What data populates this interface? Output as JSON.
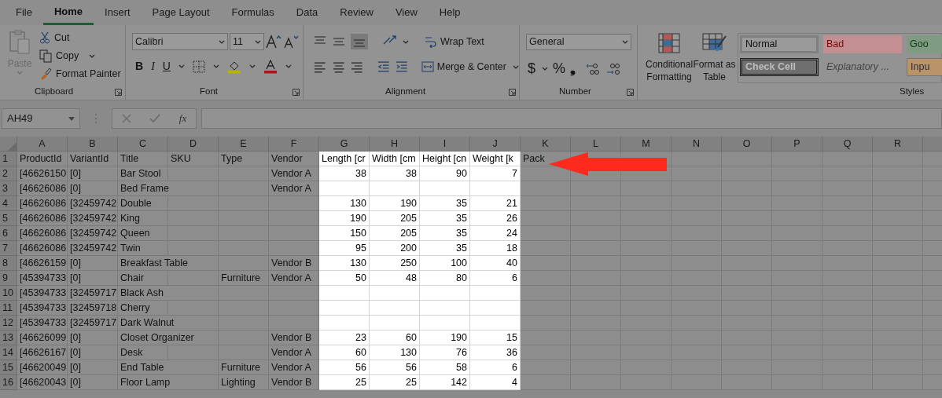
{
  "menu_tabs": [
    {
      "label": "File",
      "selected": false
    },
    {
      "label": "Home",
      "selected": true
    },
    {
      "label": "Insert",
      "selected": false
    },
    {
      "label": "Page Layout",
      "selected": false
    },
    {
      "label": "Formulas",
      "selected": false
    },
    {
      "label": "Data",
      "selected": false
    },
    {
      "label": "Review",
      "selected": false
    },
    {
      "label": "View",
      "selected": false
    },
    {
      "label": "Help",
      "selected": false
    }
  ],
  "ribbon": {
    "clipboard": {
      "label": "Clipboard",
      "paste": {
        "label": "Paste",
        "disabled": true
      },
      "cut": "Cut",
      "copy": "Copy",
      "format_painter": "Format Painter"
    },
    "font": {
      "label": "Font",
      "font_name": "Calibri",
      "font_size": "11",
      "bold": "B",
      "italic": "I",
      "underline": "U"
    },
    "alignment": {
      "label": "Alignment",
      "wrap_text": "Wrap Text",
      "merge": "Merge & Center"
    },
    "number": {
      "label": "Number",
      "format": "General",
      "currency": "$",
      "percent": "%",
      "comma": "❟"
    },
    "styles": {
      "label": "Styles",
      "conditional": [
        "Conditional",
        "Formatting"
      ],
      "format_table": [
        "Format as",
        "Table"
      ],
      "gallery": [
        {
          "label": "Normal",
          "kind": "normal"
        },
        {
          "label": "Bad",
          "kind": "bad"
        },
        {
          "label": "Goo",
          "kind": "good"
        },
        {
          "label": "Check Cell",
          "kind": "check"
        },
        {
          "label": "Explanatory ...",
          "kind": "explanatory"
        },
        {
          "label": "Inpu",
          "kind": "input"
        }
      ]
    }
  },
  "name_box": "AH49",
  "insert_function": "fx",
  "sheet": {
    "columns": [
      {
        "letter": "A",
        "highlighted": false
      },
      {
        "letter": "B",
        "highlighted": false
      },
      {
        "letter": "C",
        "highlighted": false
      },
      {
        "letter": "D",
        "highlighted": false
      },
      {
        "letter": "E",
        "highlighted": false
      },
      {
        "letter": "F",
        "highlighted": false
      },
      {
        "letter": "G",
        "highlighted": true,
        "numeric": true
      },
      {
        "letter": "H",
        "highlighted": true,
        "numeric": true
      },
      {
        "letter": "I",
        "highlighted": true,
        "numeric": true
      },
      {
        "letter": "J",
        "highlighted": true,
        "numeric": true
      },
      {
        "letter": "K",
        "highlighted": false
      },
      {
        "letter": "L",
        "highlighted": false
      },
      {
        "letter": "M",
        "highlighted": false
      },
      {
        "letter": "N",
        "highlighted": false
      },
      {
        "letter": "O",
        "highlighted": false
      },
      {
        "letter": "P",
        "highlighted": false
      },
      {
        "letter": "Q",
        "highlighted": false
      },
      {
        "letter": "R",
        "highlighted": false
      }
    ],
    "rows": [
      {
        "number": "1",
        "kind": "header",
        "cells": {
          "A": "ProductId",
          "B": "VariantId",
          "C": "Title",
          "D": "SKU",
          "E": "Type",
          "F": "Vendor",
          "G": "Length [cr",
          "H": "Width [cm",
          "I": "Height [cn",
          "J": "Weight [k",
          "K": "Pack"
        }
      },
      {
        "number": "2",
        "kind": "data",
        "cells": {
          "A": "[46626150",
          "B": "[0]",
          "C": "Bar Stool",
          "F": "Vendor A",
          "G": "38",
          "H": "38",
          "I": "90",
          "J": "7"
        }
      },
      {
        "number": "3",
        "kind": "data",
        "cells": {
          "A": "[46626086",
          "B": "[0]",
          "C": "Bed Frame",
          "F": "Vendor A"
        }
      },
      {
        "number": "4",
        "kind": "data",
        "cells": {
          "A": "[46626086",
          "B": "[32459742",
          "C": "Double",
          "G": "130",
          "H": "190",
          "I": "35",
          "J": "21"
        }
      },
      {
        "number": "5",
        "kind": "data",
        "cells": {
          "A": "[46626086",
          "B": "[32459742",
          "C": "King",
          "G": "190",
          "H": "205",
          "I": "35",
          "J": "26"
        }
      },
      {
        "number": "6",
        "kind": "data",
        "cells": {
          "A": "[46626086",
          "B": "[32459742",
          "C": "Queen",
          "G": "150",
          "H": "205",
          "I": "35",
          "J": "24"
        }
      },
      {
        "number": "7",
        "kind": "data",
        "cells": {
          "A": "[46626086",
          "B": "[32459742",
          "C": "Twin",
          "G": "95",
          "H": "200",
          "I": "35",
          "J": "18"
        }
      },
      {
        "number": "8",
        "kind": "data",
        "cells": {
          "A": "[46626159",
          "B": "[0]",
          "C": "Breakfast Table",
          "F": "Vendor B",
          "G": "130",
          "H": "250",
          "I": "100",
          "J": "40"
        }
      },
      {
        "number": "9",
        "kind": "data",
        "cells": {
          "A": "[45394733",
          "B": "[0]",
          "C": "Chair",
          "E": "Furniture",
          "F": "Vendor A",
          "G": "50",
          "H": "48",
          "I": "80",
          "J": "6"
        }
      },
      {
        "number": "10",
        "kind": "data",
        "cells": {
          "A": "[45394733",
          "B": "[32459717",
          "C": "Black Ash"
        }
      },
      {
        "number": "11",
        "kind": "data",
        "cells": {
          "A": "[45394733",
          "B": "[32459718",
          "C": "Cherry"
        }
      },
      {
        "number": "12",
        "kind": "data",
        "cells": {
          "A": "[45394733",
          "B": "[32459717",
          "C": "Dark Walnut"
        }
      },
      {
        "number": "13",
        "kind": "data",
        "cells": {
          "A": "[46626099",
          "B": "[0]",
          "C": "Closet Organizer",
          "F": "Vendor B",
          "G": "23",
          "H": "60",
          "I": "190",
          "J": "15"
        }
      },
      {
        "number": "14",
        "kind": "data",
        "cells": {
          "A": "[46626167",
          "B": "[0]",
          "C": "Desk",
          "F": "Vendor A",
          "G": "60",
          "H": "130",
          "I": "76",
          "J": "36"
        }
      },
      {
        "number": "15",
        "kind": "data",
        "cells": {
          "A": "[46620049",
          "B": "[0]",
          "C": "End Table",
          "E": "Furniture",
          "F": "Vendor A",
          "G": "56",
          "H": "56",
          "I": "58",
          "J": "6"
        }
      },
      {
        "number": "16",
        "kind": "data",
        "cells": {
          "A": "[46620043",
          "B": "[0]",
          "C": "Floor Lamp",
          "E": "Lighting",
          "F": "Vendor B",
          "G": "25",
          "H": "25",
          "I": "142",
          "J": "4"
        }
      }
    ]
  }
}
